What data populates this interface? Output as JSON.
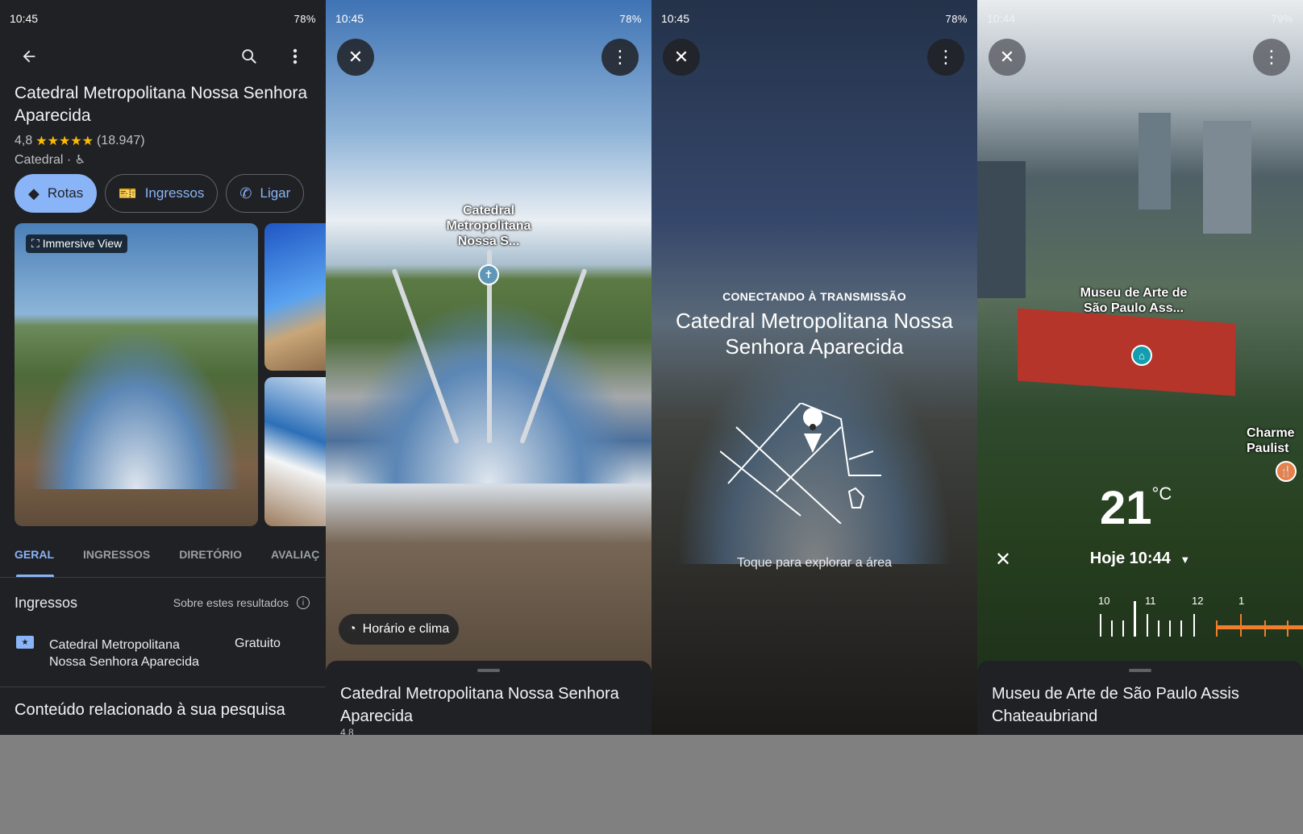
{
  "panel1": {
    "status": {
      "time": "10:45",
      "right": "78%"
    },
    "title": "Catedral Metropolitana Nossa Senhora Aparecida",
    "rating": "4,8",
    "stars": "★★★★★",
    "reviews": "(18.947)",
    "category": "Catedral ·",
    "chips": [
      {
        "label": "Rotas",
        "icon": "directions-icon"
      },
      {
        "label": "Ingressos",
        "icon": "ticket-icon"
      },
      {
        "label": "Ligar",
        "icon": "phone-icon"
      }
    ],
    "immersive_badge": "Immersive View",
    "tabs": [
      "GERAL",
      "INGRESSOS",
      "DIRETÓRIO",
      "AVALIAÇ"
    ],
    "tickets_title": "Ingressos",
    "about_results": "Sobre estes resultados",
    "ticket_name": "Catedral Metropolitana Nossa Senhora Aparecida",
    "ticket_price": "Gratuito",
    "related": "Conteúdo relacionado à sua pesquisa"
  },
  "panel2": {
    "status": {
      "time": "10:45",
      "right": "78%"
    },
    "place_label": "Catedral Metropolitana Nossa S...",
    "weather_chip": "Horário e clima",
    "sheet_title": "Catedral Metropolitana Nossa Senhora Aparecida",
    "sheet_rating": "4,8"
  },
  "panel3": {
    "status": {
      "time": "10:45",
      "right": "78%"
    },
    "connecting": "CONECTANDO À TRANSMISSÃO",
    "title": "Catedral Metropolitana Nossa Senhora Aparecida",
    "explore": "Toque para explorar a área"
  },
  "panel4": {
    "status": {
      "time": "10:44",
      "right": "79%"
    },
    "place_label": "Museu de Arte de São Paulo Ass...",
    "side_label": "Charme Paulist",
    "temperature": "21",
    "unit": "°C",
    "time_label": "Hoje 10:44",
    "timeline_labels": [
      "10",
      "11",
      "12",
      "1"
    ],
    "sheet_title": "Museu de Arte de São Paulo Assis Chateaubriand"
  },
  "colors": {
    "accent": "#8ab4f8",
    "dark_bg": "#202124",
    "star": "#fbbc04",
    "timeline": "#f07d2b"
  }
}
